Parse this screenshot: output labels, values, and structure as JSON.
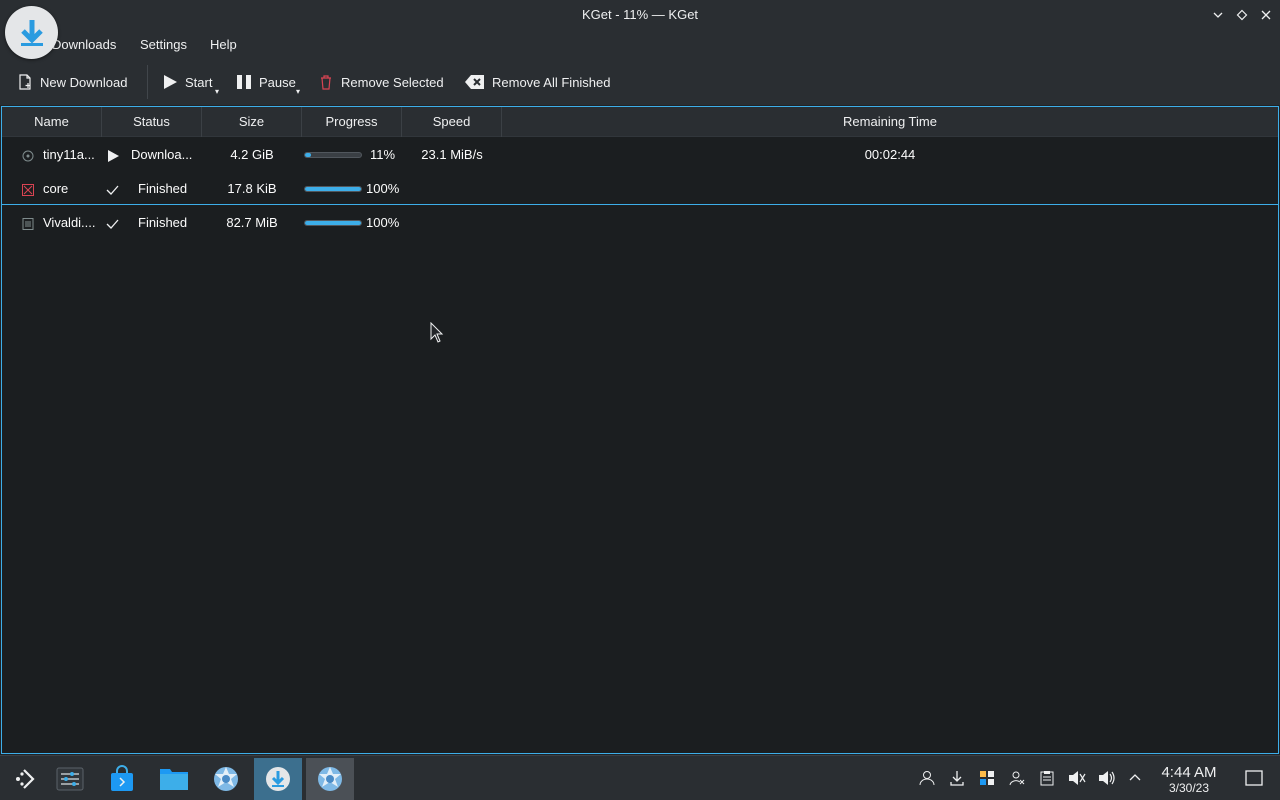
{
  "window": {
    "title": "KGet - 11% — KGet"
  },
  "menu": [
    "Downloads",
    "Settings",
    "Help"
  ],
  "toolbar": {
    "new_download": "New Download",
    "start": "Start",
    "pause": "Pause",
    "remove_selected": "Remove Selected",
    "remove_all_finished": "Remove All Finished"
  },
  "table": {
    "columns": [
      "Name",
      "Status",
      "Size",
      "Progress",
      "Speed",
      "Remaining Time"
    ],
    "rows": [
      {
        "name": "tiny11a...",
        "status": "Downloa...",
        "status_icon": "play-icon",
        "size": "4.2 GiB",
        "progress": 11,
        "progress_text": "11%",
        "speed": "23.1 MiB/s",
        "remaining": "00:02:44",
        "file_icon": "disc-image-icon"
      },
      {
        "name": "core",
        "status": "Finished",
        "status_icon": "check-icon",
        "size": "17.8 KiB",
        "progress": 100,
        "progress_text": "100%",
        "speed": "",
        "remaining": "",
        "file_icon": "broken-file-icon"
      },
      {
        "name": "Vivaldi....",
        "status": "Finished",
        "status_icon": "check-icon",
        "size": "82.7 MiB",
        "progress": 100,
        "progress_text": "100%",
        "speed": "",
        "remaining": "",
        "file_icon": "document-icon"
      }
    ]
  },
  "taskbar": {
    "apps": [
      "application-launcher-icon",
      "system-settings-icon",
      "discover-store-icon",
      "file-manager-icon",
      "vivaldi-browser-icon",
      "kget-icon",
      "vivaldi-browser-icon"
    ],
    "clock_time": "4:44 AM",
    "clock_date": "3/30/23"
  },
  "colors": {
    "accent": "#3daee9",
    "background": "#1b1e20",
    "panel": "#2a2e32"
  }
}
